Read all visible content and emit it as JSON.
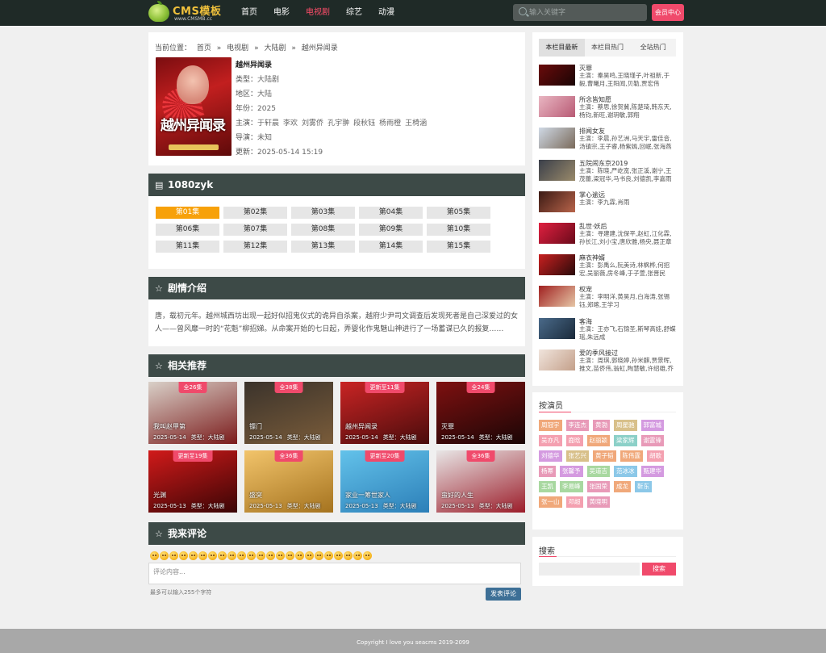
{
  "site": {
    "logo_title": "CMS模板",
    "logo_sub": "www.CMSMB.cc",
    "nav": [
      "首页",
      "电影",
      "电视剧",
      "综艺",
      "动漫"
    ],
    "nav_active_index": 2,
    "search_placeholder": "输入关键字",
    "login_label": "会员中心"
  },
  "breadcrumb": [
    "当前位置：",
    "首页",
    "»",
    "电视剧",
    "»",
    "大陆剧",
    "»",
    "越州异闻录"
  ],
  "detail": {
    "poster_title": "越州异闻录",
    "title": "越州异闻录",
    "type_label": "类型：",
    "type": "大陆剧",
    "region_label": "地区：",
    "region": "大陆",
    "year_label": "年份：",
    "year": "2025",
    "cast_label": "主演：",
    "cast": [
      "于轩晨",
      "李欢",
      "刘雾侨",
      "孔宇翀",
      "段秋钰",
      "杨雨橙",
      "王椅涵"
    ],
    "director_label": "导演：",
    "director": "未知",
    "updated_label": "更新：",
    "updated": "2025-05-14 15:19"
  },
  "source": {
    "title": "1080zyk",
    "active_index": 0,
    "episodes": [
      "第01集",
      "第02集",
      "第03集",
      "第04集",
      "第05集",
      "第06集",
      "第07集",
      "第08集",
      "第09集",
      "第10集",
      "第11集",
      "第12集",
      "第13集",
      "第14集",
      "第15集"
    ]
  },
  "synopsis": {
    "title": "剧情介绍",
    "text": "唐，载初元年。越州城西坊出现一起好似招鬼仪式的诡异自杀案，越府少尹司文调查后发现死者是自己深爱过的女人——曾风靡一时的“花魁”柳招娣。从命案开始的七日起，弄婴化作鬼魅山神进行了一场蓄谋已久的报复……"
  },
  "related": {
    "title": "相关推荐",
    "items": [
      {
        "badge": "全26集",
        "name": "我叫赵甲第",
        "date": "2025-05-14",
        "type": "类型：大陆剧",
        "colors": [
          "#d9d0c8",
          "#7b1b1b"
        ]
      },
      {
        "badge": "全38集",
        "name": "镖门",
        "date": "2025-05-14",
        "type": "类型：大陆剧",
        "colors": [
          "#3b332b",
          "#7a5c3a"
        ]
      },
      {
        "badge": "更新至11集",
        "name": "越州异闻录",
        "date": "2025-05-14",
        "type": "类型：大陆剧",
        "colors": [
          "#c92424",
          "#4a0c0c"
        ]
      },
      {
        "badge": "全24集",
        "name": "灭罪",
        "date": "2025-05-14",
        "type": "类型：大陆剧",
        "colors": [
          "#7e1010",
          "#1a0606"
        ]
      },
      {
        "badge": "更新至19集",
        "name": "光渊",
        "date": "2025-05-13",
        "type": "类型：大陆剧",
        "colors": [
          "#d11a1a",
          "#3a0505"
        ]
      },
      {
        "badge": "全36集",
        "name": "盛突",
        "date": "2025-05-13",
        "type": "类型：大陆剧",
        "colors": [
          "#f2c46b",
          "#a5731f"
        ]
      },
      {
        "badge": "更新至20集",
        "name": "家业一筹世家人",
        "date": "2025-05-13",
        "type": "类型：大陆剧",
        "colors": [
          "#63c2ea",
          "#2c7fb8"
        ]
      },
      {
        "badge": "全36集",
        "name": "蛮好的人生",
        "date": "2025-05-13",
        "type": "类型：大陆剧",
        "colors": [
          "#e8e6e6",
          "#9c1d2a"
        ]
      }
    ]
  },
  "comment": {
    "title": "我来评论",
    "placeholder": "评论内容...",
    "hint": "最多可以输入255个字符",
    "submit": "发表评论"
  },
  "sidebar": {
    "tabs": [
      "本栏目最新",
      "本栏目热门",
      "全站热门"
    ],
    "active_tab": 0,
    "items": [
      {
        "title": "灭罪",
        "cast": "主演：秦昊鸣,王晓瑾子,叶祖新,于毅,曹曦月,王阳闻,贝勒,贾宏伟",
        "colors": [
          "#6a0b0b",
          "#1a0505"
        ]
      },
      {
        "title": "所念皆知愿",
        "cast": "主演：蔡思,徐贺冀,陈楚琦,韩东天,杨钧,新旺,谢玥敏,郭翔",
        "colors": [
          "#e9b6c2",
          "#b85a74"
        ]
      },
      {
        "title": "排闻女友",
        "cast": "主演：李晨,孙艺洲,马天宇,雷佳音,汤镇宗,王子睿,杨紫嫣,回岷,张海燕",
        "colors": [
          "#cfd9e6",
          "#7a6a5a"
        ]
      },
      {
        "title": "五院闹东京2019",
        "cast": "主演：陈晓,严屹宽,张正溪,谢宁,王茂蕾,梁冠华,马书良,刘德凯,李嘉雨",
        "colors": [
          "#3a3f4a",
          "#9a8a6a"
        ]
      },
      {
        "title": "掌心逾远",
        "cast": "主演：李九霖,肖雨",
        "colors": [
          "#3b1a14",
          "#b8644a"
        ]
      },
      {
        "title": "乱世·妖后",
        "cast": "主演：寻建建,沈保平,赵虹,江化霖,孙长江,刘小宝,唐欣雅,杨央,聂正章",
        "colors": [
          "#e02040",
          "#6a0a1a"
        ]
      },
      {
        "title": "麻衣神婿",
        "cast": "主演：彭禹么,阮美诗,林枫桦,何招宏,吴丽薇,房冬峰,于子萱,张晋民",
        "colors": [
          "#c92020",
          "#2a0a0a"
        ]
      },
      {
        "title": "权宠",
        "cast": "主演：李明洋,黄昊月,白海涛,张锡钰,郑喀,王学习",
        "colors": [
          "#a02020",
          "#e6c6a6"
        ]
      },
      {
        "title": "客海",
        "cast": "主演：王亦飞,石锦圣,斯琴高娃,舒蝶瑶,朱远成",
        "colors": [
          "#4a6a8a",
          "#1a2a3a"
        ]
      },
      {
        "title": "爱的季风接过",
        "cast": "主演：周琪,郭晓婷,孙米麒,贾景晖,推文,苗侨伟,翁虹,陶慧敏,许绍雄,乔",
        "colors": [
          "#f0e4dc",
          "#c4a08a"
        ]
      }
    ]
  },
  "actors": {
    "title": "按演员",
    "list": [
      {
        "name": "周冠宇",
        "color": "#f0a87a"
      },
      {
        "name": "李连杰",
        "color": "#e89ab8"
      },
      {
        "name": "黄渤",
        "color": "#e89ab8"
      },
      {
        "name": "周星驰",
        "color": "#d8c08a"
      },
      {
        "name": "郭富城",
        "color": "#d49ae0"
      },
      {
        "name": "吴亦凡",
        "color": "#f4a0b0"
      },
      {
        "name": "鹿晗",
        "color": "#f4a0b0"
      },
      {
        "name": "赵丽颖",
        "color": "#f0a87a"
      },
      {
        "name": "梁家辉",
        "color": "#8cd0c8"
      },
      {
        "name": "谢霆锋",
        "color": "#e89ab8"
      },
      {
        "name": "刘德华",
        "color": "#d49ae0"
      },
      {
        "name": "张艺兴",
        "color": "#d8c08a"
      },
      {
        "name": "黄子韬",
        "color": "#f0a87a"
      },
      {
        "name": "陈伟霆",
        "color": "#f0a87a"
      },
      {
        "name": "胡歌",
        "color": "#f4a0b0"
      },
      {
        "name": "杨幂",
        "color": "#e89ab8"
      },
      {
        "name": "张馨予",
        "color": "#d49ae0"
      },
      {
        "name": "吴道吉",
        "color": "#a8d8a0"
      },
      {
        "name": "范冰冰",
        "color": "#8cc8e8"
      },
      {
        "name": "甄建华",
        "color": "#d49ae0"
      },
      {
        "name": "王凯",
        "color": "#a8d8a0"
      },
      {
        "name": "李易峰",
        "color": "#a8d8a0"
      },
      {
        "name": "张国荣",
        "color": "#e89ab8"
      },
      {
        "name": "成龙",
        "color": "#f0a87a"
      },
      {
        "name": "靳东",
        "color": "#8cc8e8"
      },
      {
        "name": "张一山",
        "color": "#f0a87a"
      },
      {
        "name": "邓超",
        "color": "#f4a0b0"
      },
      {
        "name": "黄晓明",
        "color": "#e89ab8"
      }
    ]
  },
  "search_box": {
    "title": "搜索",
    "button": "搜索"
  },
  "footer": "Copyright I love you seacms 2019-2099"
}
